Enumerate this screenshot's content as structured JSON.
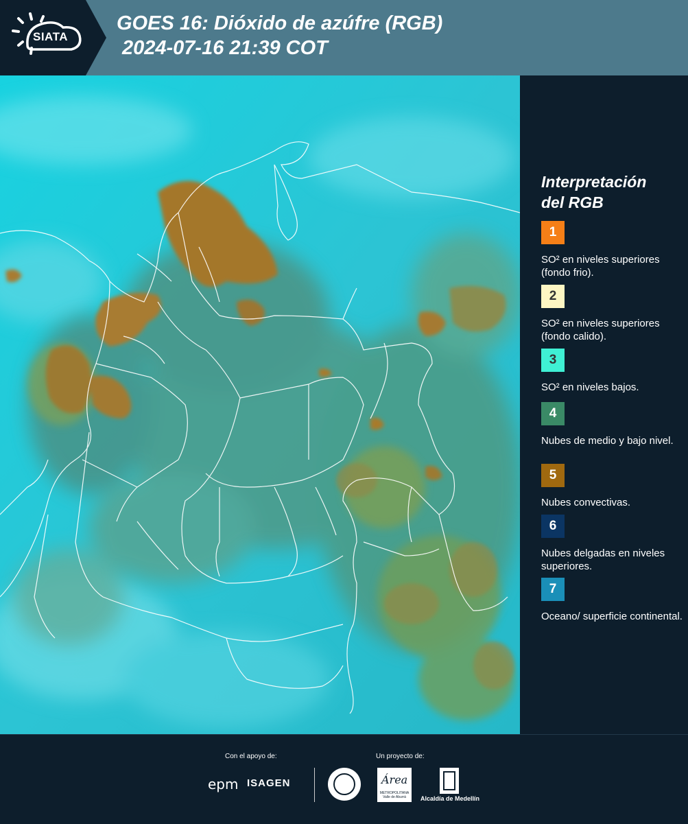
{
  "header": {
    "logo_text": "SIATA",
    "title_line1": "GOES 16: Dióxido de azúfre (RGB)",
    "title_line2": "2024-07-16 21:39 COT"
  },
  "legend": {
    "title_line1": "Interpretación",
    "title_line2": "del RGB",
    "items": [
      {
        "number": "1",
        "color": "#f57f17",
        "text": "SO² en niveles superiores (fondo frio)."
      },
      {
        "number": "2",
        "color": "#fdf6c3",
        "text": "SO² en niveles superiores (fondo calido)."
      },
      {
        "number": "3",
        "color": "#3ff0d4",
        "text": "SO² en niveles bajos."
      },
      {
        "number": "4",
        "color": "#3a8a66",
        "text": "Nubes de medio y bajo nivel."
      },
      {
        "number": "5",
        "color": "#a0690f",
        "text": "Nubes convectivas."
      },
      {
        "number": "6",
        "color": "#0b3563",
        "text": "Nubes delgadas en niveles superiores."
      },
      {
        "number": "7",
        "color": "#1a8fb8",
        "text": "Oceano/ superficie continental."
      }
    ]
  },
  "footer": {
    "support_label": "Con el apoyo de:",
    "project_label": "Un proyecto de:",
    "epm": "epm",
    "isagen": "ISAGEN",
    "area_word": "Área",
    "area_sub": "METROPOLITANA Valle de Aburrá",
    "alcaldia": "Alcaldía de Medellín"
  }
}
